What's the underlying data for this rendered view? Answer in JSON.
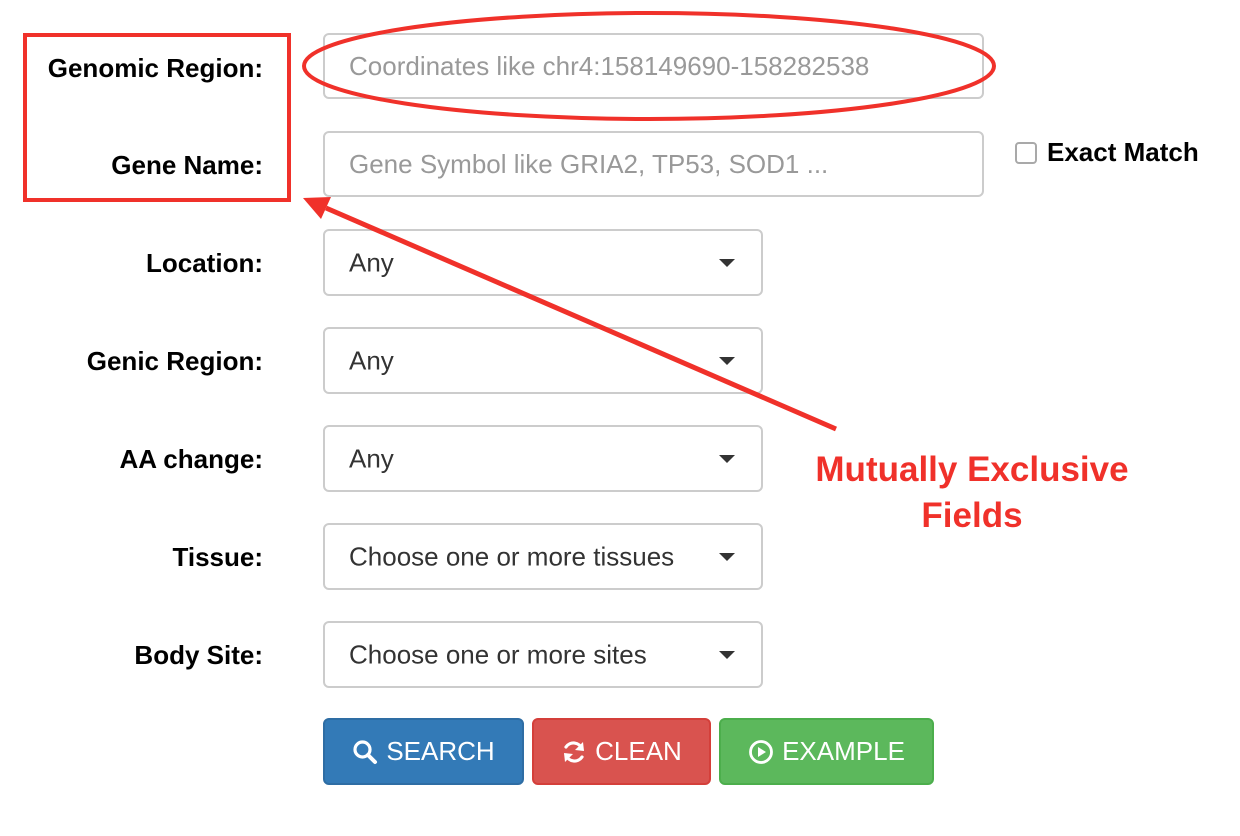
{
  "form": {
    "genomic_region": {
      "label": "Genomic Region:",
      "placeholder": "Coordinates like chr4:158149690-158282538"
    },
    "gene_name": {
      "label": "Gene Name:",
      "placeholder": "Gene Symbol like GRIA2, TP53, SOD1 ...",
      "exact_match_label": "Exact Match"
    },
    "location": {
      "label": "Location:",
      "value": "Any"
    },
    "genic_region": {
      "label": "Genic Region:",
      "value": "Any"
    },
    "aa_change": {
      "label": "AA change:",
      "value": "Any"
    },
    "tissue": {
      "label": "Tissue:",
      "value": "Choose one or more tissues"
    },
    "body_site": {
      "label": "Body Site:",
      "value": "Choose one or more sites"
    }
  },
  "buttons": {
    "search": "SEARCH",
    "clean": "CLEAN",
    "example": "EXAMPLE"
  },
  "annotation": {
    "line1": "Mutually Exclusive",
    "line2": "Fields",
    "color": "#f0312a"
  },
  "colors": {
    "search": "#337ab7",
    "clean": "#d9534f",
    "example": "#5cb85c"
  },
  "icons": {
    "search": "search-icon",
    "clean": "refresh-icon",
    "example": "play-circle-icon",
    "select_caret": "caret-down-icon"
  }
}
